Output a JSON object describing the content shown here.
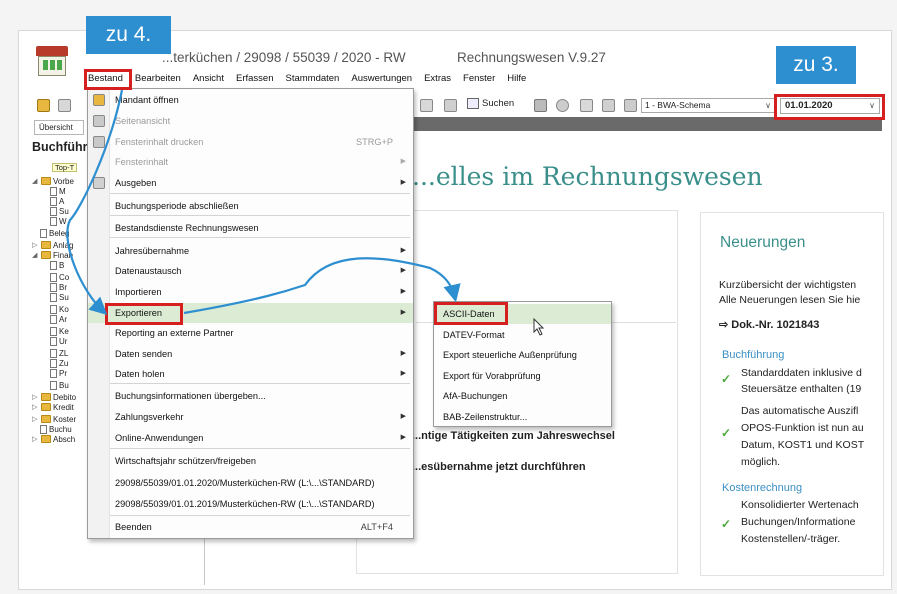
{
  "window": {
    "title": "...terküchen / 29098 / 55039 / 2020 - RW",
    "app_name": "Rechnungswesen V.9.27"
  },
  "menubar": [
    "Bestand",
    "Bearbeiten",
    "Ansicht",
    "Erfassen",
    "Stammdaten",
    "Auswertungen",
    "Extras",
    "Fenster",
    "Hilfe"
  ],
  "toolbar": {
    "search_label": "Suchen",
    "schema_select": "1 - BWA-Schema",
    "date_select": "01.01.2020"
  },
  "left_panel": {
    "tab": "Übersicht",
    "title": "Buchführ",
    "tree": [
      {
        "label": "Top-T",
        "type": "top"
      },
      {
        "label": "Vorbe",
        "type": "folder",
        "expand": "◢"
      },
      {
        "label": "M",
        "type": "doc"
      },
      {
        "label": "A",
        "type": "doc"
      },
      {
        "label": "Su",
        "type": "doc"
      },
      {
        "label": "W",
        "type": "doc"
      },
      {
        "label": "Beleg",
        "type": "doc"
      },
      {
        "label": "Anlag",
        "type": "folder",
        "expand": "▷"
      },
      {
        "label": "Finan",
        "type": "folder",
        "expand": "◢"
      },
      {
        "label": "B",
        "type": "doc"
      },
      {
        "label": "Co",
        "type": "doc"
      },
      {
        "label": "Br",
        "type": "doc"
      },
      {
        "label": "Su",
        "type": "doc"
      },
      {
        "label": "Ko",
        "type": "doc"
      },
      {
        "label": "Ar",
        "type": "doc"
      },
      {
        "label": "Ke",
        "type": "doc"
      },
      {
        "label": "Ur",
        "type": "doc"
      },
      {
        "label": "ZL",
        "type": "doc"
      },
      {
        "label": "Zu",
        "type": "doc"
      },
      {
        "label": "Pr",
        "type": "doc"
      },
      {
        "label": "Bu",
        "type": "doc"
      },
      {
        "label": "Debito",
        "type": "folder",
        "expand": "▷"
      },
      {
        "label": "Kredit",
        "type": "folder",
        "expand": "▷"
      },
      {
        "label": "Koster",
        "type": "folder",
        "expand": "▷"
      },
      {
        "label": "Buchu",
        "type": "doc"
      },
      {
        "label": "Absch",
        "type": "folder",
        "expand": "▷"
      }
    ]
  },
  "main": {
    "heading": "...elles im Rechnungswesen",
    "line1": "...ntige Tätigkeiten zum Jahreswechsel",
    "line2": "...esübernahme jetzt durchführen"
  },
  "news": {
    "title": "Neuerungen",
    "intro1": "Kurzübersicht der wichtigsten",
    "intro2": "Alle Neuerungen lesen Sie hie",
    "doc_nr": "⇨ Dok.-Nr. 1021843",
    "sec1": "Buchführung",
    "b1_l1": "Standarddaten inklusive d",
    "b1_l2": "Steuersätze enthalten (19",
    "b2_l1": "Das automatische Auszifl",
    "b2_l2": "OPOS-Funktion ist nun au",
    "b2_l3": "Datum, KOST1 und KOST",
    "b2_l4": "möglich.",
    "sec2": "Kostenrechnung",
    "b3_l1": "Konsolidierter Wertenach",
    "b3_l2": "Buchungen/Informatione",
    "b3_l3": "Kostenstellen/-träger.",
    "check": "✓"
  },
  "dropdown": [
    {
      "label": "Mandant öffnen",
      "shortcut": "",
      "sub": false,
      "disabled": false
    },
    {
      "label": "Seitenansicht",
      "shortcut": "",
      "sub": false,
      "disabled": true
    },
    {
      "label": "Fensterinhalt drucken",
      "shortcut": "STRG+P",
      "sub": false,
      "disabled": true
    },
    {
      "label": "Fensterinhalt",
      "shortcut": "",
      "sub": true,
      "disabled": true
    },
    {
      "label": "Ausgeben",
      "shortcut": "",
      "sub": true,
      "disabled": false
    },
    {
      "label": "Buchungsperiode abschließen",
      "shortcut": "",
      "sub": false,
      "disabled": false
    },
    {
      "label": "Bestandsdienste Rechnungswesen",
      "shortcut": "",
      "sub": false,
      "disabled": false
    },
    {
      "label": "Jahresübernahme",
      "shortcut": "",
      "sub": true,
      "disabled": false
    },
    {
      "label": "Datenaustausch",
      "shortcut": "",
      "sub": true,
      "disabled": false
    },
    {
      "label": "Importieren",
      "shortcut": "",
      "sub": true,
      "disabled": false
    },
    {
      "label": "Exportieren",
      "shortcut": "",
      "sub": true,
      "disabled": false
    },
    {
      "label": "Reporting an externe Partner",
      "shortcut": "",
      "sub": false,
      "disabled": false
    },
    {
      "label": "Daten senden",
      "shortcut": "",
      "sub": true,
      "disabled": false
    },
    {
      "label": "Daten holen",
      "shortcut": "",
      "sub": true,
      "disabled": false
    },
    {
      "label": "Buchungsinformationen übergeben...",
      "shortcut": "",
      "sub": false,
      "disabled": false
    },
    {
      "label": "Zahlungsverkehr",
      "shortcut": "",
      "sub": true,
      "disabled": false
    },
    {
      "label": "Online-Anwendungen",
      "shortcut": "",
      "sub": true,
      "disabled": false
    },
    {
      "label": "Wirtschaftsjahr schützen/freigeben",
      "shortcut": "",
      "sub": false,
      "disabled": false
    },
    {
      "label": "29098/55039/01.01.2020/Musterküchen-RW (L:\\...\\STANDARD)",
      "shortcut": "",
      "sub": false,
      "disabled": false
    },
    {
      "label": "29098/55039/01.01.2019/Musterküchen-RW (L:\\...\\STANDARD)",
      "shortcut": "",
      "sub": false,
      "disabled": false
    },
    {
      "label": "Beenden",
      "shortcut": "ALT+F4",
      "sub": false,
      "disabled": false
    }
  ],
  "submenu": [
    "ASCII-Daten",
    "DATEV-Format",
    "Export steuerliche Außenprüfung",
    "Export für Vorabprüfung",
    "AfA-Buchungen",
    "BAB-Zeilenstruktur..."
  ],
  "annotations": {
    "step4": "zu 4.",
    "step3": "zu 3."
  },
  "colors": {
    "teal_heading": "#3a8f8a",
    "callout_blue": "#2d8ed0",
    "highlight_red": "#d62020",
    "menu_hover": "#dcecd4"
  }
}
